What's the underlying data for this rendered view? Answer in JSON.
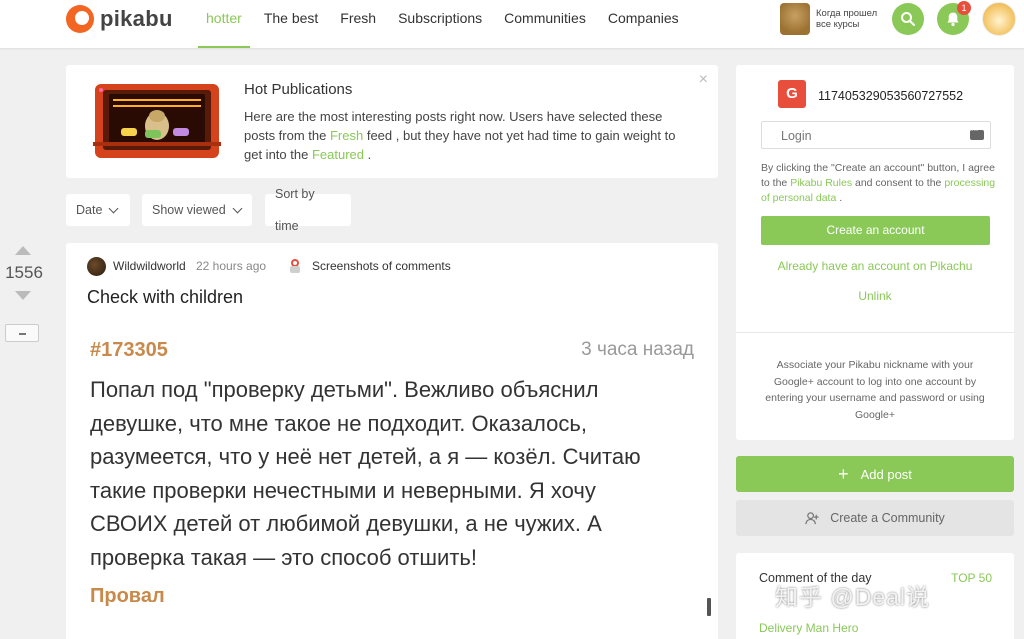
{
  "header": {
    "logo_text": "pikabu",
    "nav": [
      {
        "label": "hotter",
        "active": true
      },
      {
        "label": "The best",
        "active": false
      },
      {
        "label": "Fresh",
        "active": false
      },
      {
        "label": "Subscriptions",
        "active": false
      },
      {
        "label": "Communities",
        "active": false
      },
      {
        "label": "Companies",
        "active": false
      }
    ],
    "promo_text": "Когда прошел все курсы",
    "search_icon": "search-icon",
    "notifications_count": "1",
    "accent_color": "#8ac858"
  },
  "hot": {
    "title": "Hot Publications",
    "desc_1": "Here are the most interesting posts right now. Users have selected these posts from the ",
    "desc_link_fresh": "Fresh",
    "desc_2": " feed , but they have not yet had time to gain weight to get into the ",
    "desc_link_featured": "Featured",
    "desc_3": " .",
    "close": "×"
  },
  "filters": {
    "date": "Date",
    "show_viewed": "Show viewed",
    "sort": "Sort by time"
  },
  "vote": {
    "count": "1556"
  },
  "post": {
    "author": "Wildwildworld",
    "time": "22 hours ago",
    "community": "Screenshots of comments",
    "title": "Check with children",
    "screenshot": {
      "id": "#173305",
      "time": "3 часа назад",
      "text": "Попал под \"проверку детьми\". Вежливо объяснил девушке, что мне такое не подходит. Оказалось, разумеется, что у неё нет детей, а я — козёл. Считаю такие проверки нечестными и неверными. Я хочу СВОИХ детей от любимой девушки, а не чужих. А проверка такая — это способ отшить!",
      "tag": "Провал"
    }
  },
  "sidebar": {
    "g_label": "G",
    "google_id": "117405329053560727552",
    "login_placeholder": "Login",
    "terms_1": "By clicking the \"Create an account\" button, I agree to the ",
    "terms_link_rules": "Pikabu Rules",
    "terms_2": " and consent to the ",
    "terms_link_personal": "processing of personal data",
    "terms_3": " .",
    "create_account": "Create an account",
    "already": "Already have an account on Pikachu",
    "unlink": "Unlink",
    "associate": "Associate your Pikabu nickname with your Google+ account to log into one account by entering your username and password or using Google+",
    "add_post": "Add post",
    "add_post_plus": "+",
    "create_community": "Create a Community",
    "comment_of_day": "Comment of the day",
    "top50": "TOP 50",
    "delivery": "Delivery Man Hero"
  },
  "watermark": "知乎 @Deal说"
}
